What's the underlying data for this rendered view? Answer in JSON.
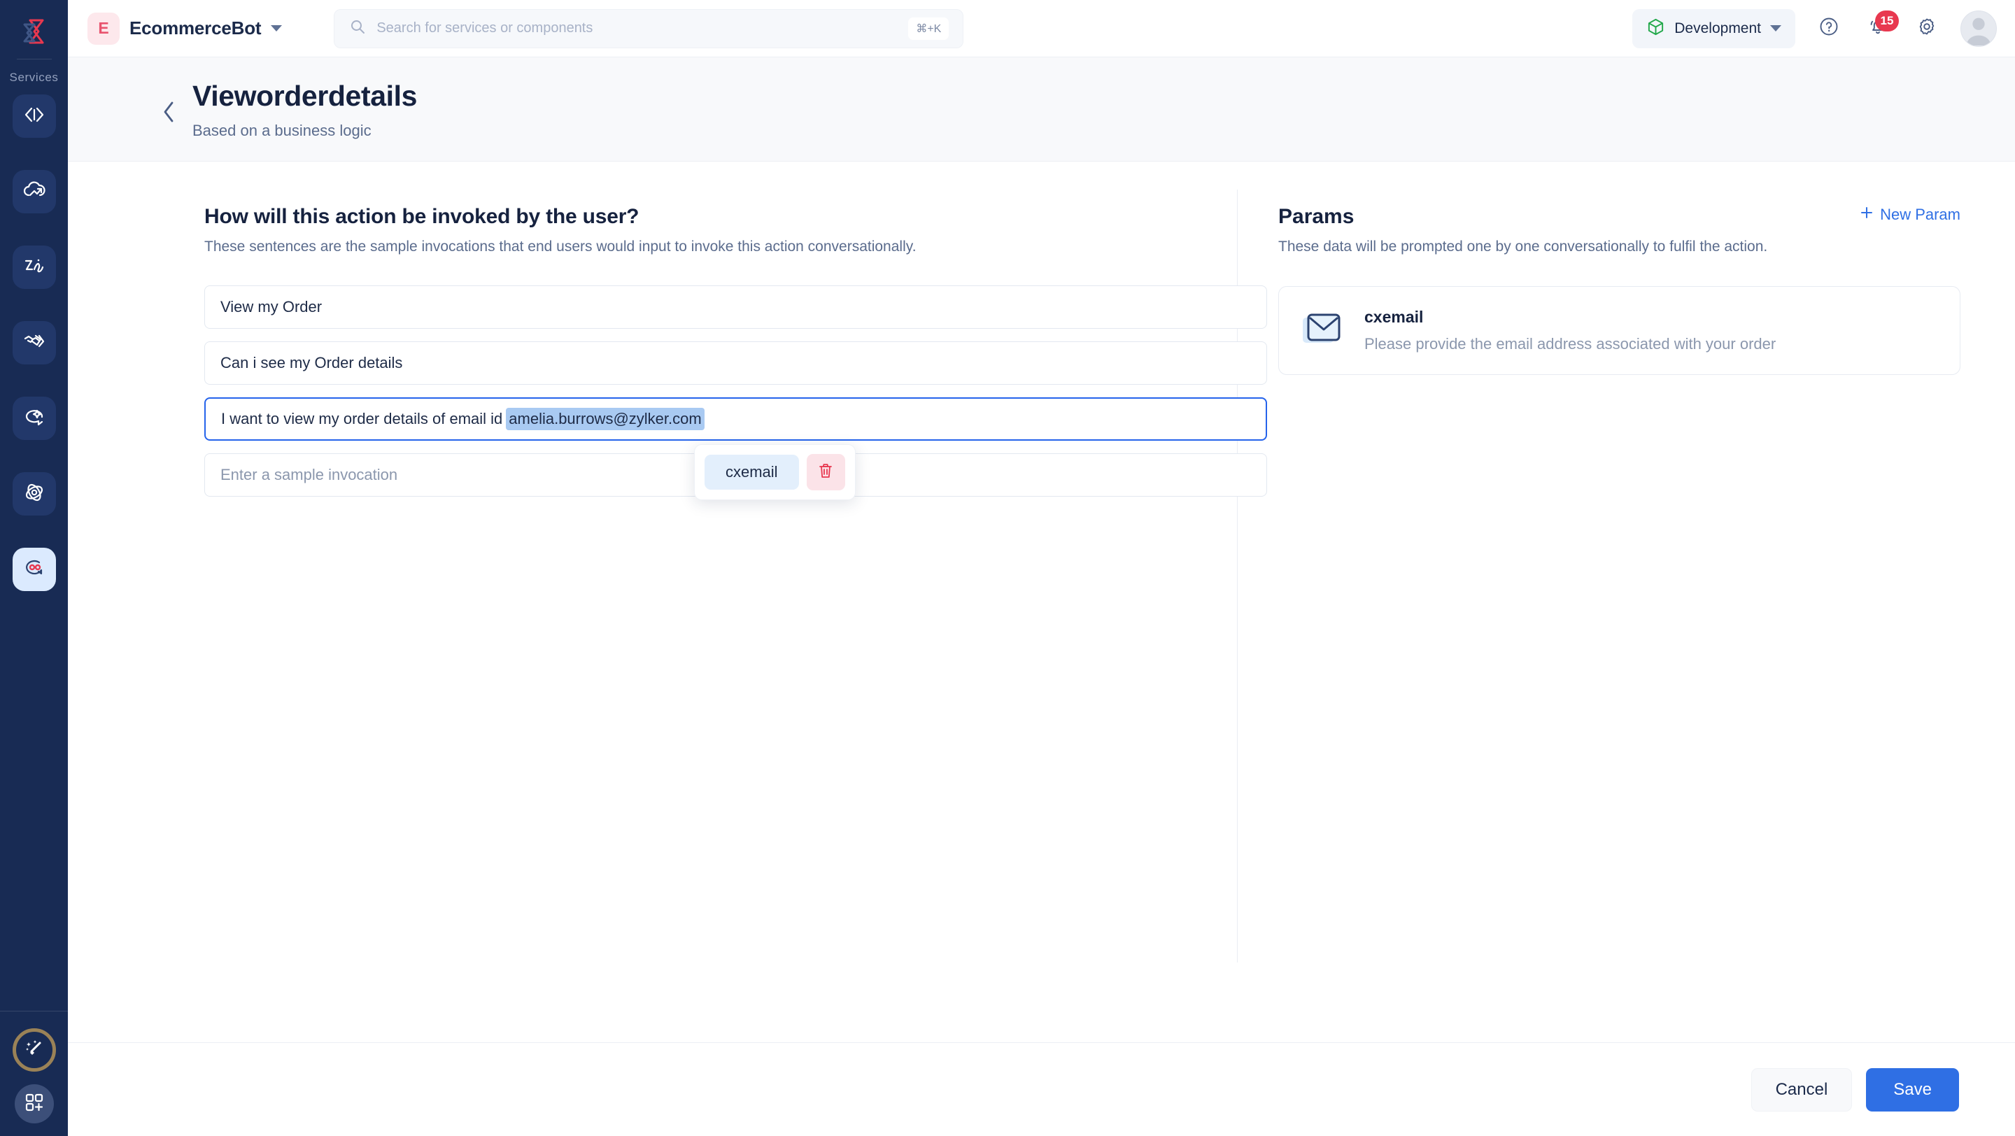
{
  "brand": {
    "logo_icon": "zoho-arrow-logo"
  },
  "rail": {
    "section_label": "Services",
    "items": [
      {
        "icon": "code-brackets-icon",
        "name": "code-service"
      },
      {
        "icon": "cloud-upload-icon",
        "name": "cloud-service"
      },
      {
        "icon": "signature-icon",
        "name": "signature-service"
      },
      {
        "icon": "handshake-icon",
        "name": "integration-service"
      },
      {
        "icon": "chat-sparkle-icon",
        "name": "assistant-service"
      },
      {
        "icon": "orbit-icon",
        "name": "orbit-service"
      },
      {
        "icon": "bot-chat-icon",
        "name": "bot-service",
        "active": true
      }
    ],
    "bottom": [
      {
        "icon": "magic-wand-icon",
        "name": "magic-assist-button"
      },
      {
        "icon": "grid-plus-icon",
        "name": "apps-button"
      }
    ]
  },
  "topbar": {
    "app_initial": "E",
    "app_name": "EcommerceBot",
    "app_caret_icon": "chevron-down-icon",
    "search": {
      "icon": "search-icon",
      "placeholder": "Search for services or components",
      "value": "",
      "shortcut": "⌘+K"
    },
    "environment": {
      "icon": "cube-icon",
      "label": "Development",
      "caret_icon": "chevron-down-icon"
    },
    "help_icon": "help-circle-icon",
    "notifications": {
      "icon": "bell-icon",
      "count": "15"
    },
    "settings_icon": "gear-icon",
    "avatar_icon": "user-avatar"
  },
  "pagehead": {
    "back_icon": "chevron-left-icon",
    "title": "Vieworderdetails",
    "subtitle": "Based on a business logic"
  },
  "invocations": {
    "title": "How will this action be invoked by the user?",
    "subtitle": "These sentences are the sample invocations that end users would input to invoke this action conversationally.",
    "rows": [
      {
        "value": "View my Order",
        "focused": false
      },
      {
        "value": "Can i see my Order details",
        "focused": false
      },
      {
        "value": "I want to view my order details of email id ",
        "highlight": "amelia.burrows@zylker.com",
        "focused": true
      },
      {
        "value": "",
        "placeholder": "Enter a sample invocation",
        "focused": false
      }
    ],
    "popover": {
      "pill_label": "cxemail",
      "delete_icon": "trash-icon"
    }
  },
  "params": {
    "title": "Params",
    "new_param_label": "New Param",
    "new_param_icon": "plus-icon",
    "subtitle": "These data will be prompted one by one conversationally to fulfil the action.",
    "cards": [
      {
        "icon": "envelope-icon",
        "name": "cxemail",
        "description": "Please provide the email address associated with your order"
      }
    ]
  },
  "footer": {
    "cancel_label": "Cancel",
    "save_label": "Save"
  },
  "colors": {
    "rail_bg": "#182B54",
    "accent_blue": "#2f6fe4",
    "focus_blue": "#2563eb",
    "badge_red": "#e8384f",
    "selection_blue": "#a9caf2",
    "gold_ring": "#9a8257",
    "env_green": "#22a84a"
  }
}
